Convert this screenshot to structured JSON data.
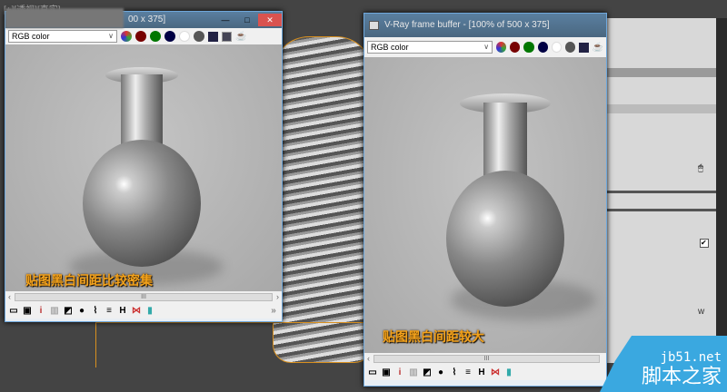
{
  "viewport": {
    "label": "[+][透视][真实]"
  },
  "left_window": {
    "title": "00 x 375]",
    "channel": "RGB color",
    "caption": "贴图黑白间距比较密集",
    "scroll_grip": "III",
    "min": "—",
    "max": "□",
    "close": "✕"
  },
  "right_window": {
    "title": "V-Ray frame buffer - [100% of 500 x 375]",
    "channel": "RGB color",
    "caption": "贴图黑白间距较大",
    "scroll_grip": "III"
  },
  "right_panel": {
    "fragment": "w"
  },
  "watermark": {
    "site": "jb51.net",
    "name": "脚本之家"
  },
  "colors": {
    "caption": "#f3a21b",
    "title_bar": "#4a6780",
    "watermark": "#3aa8e0"
  }
}
